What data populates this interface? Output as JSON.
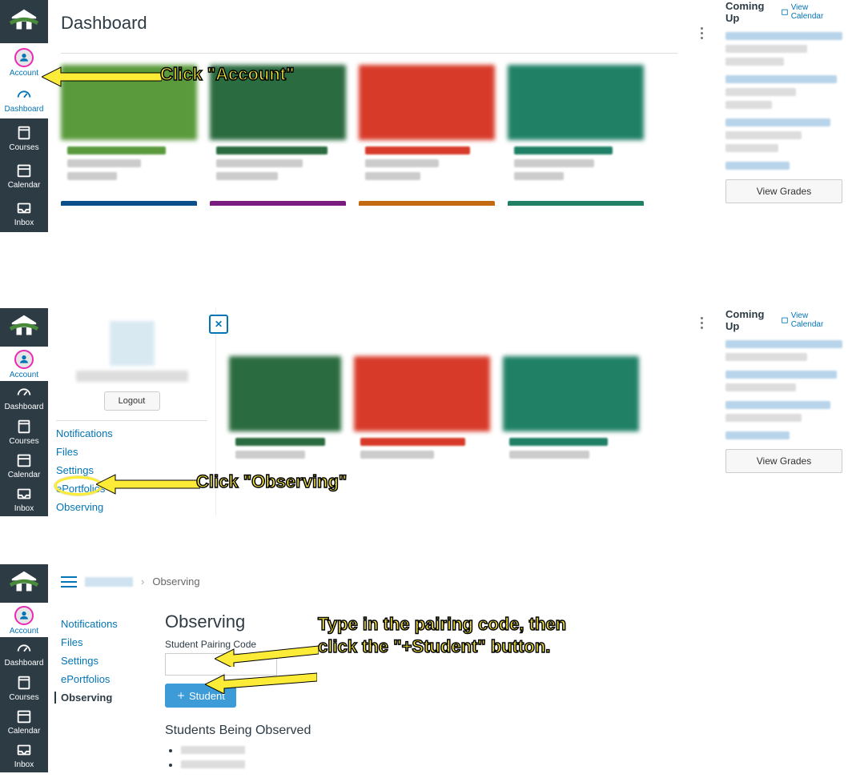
{
  "sidebar": {
    "account": "Account",
    "dashboard": "Dashboard",
    "courses": "Courses",
    "calendar": "Calendar",
    "inbox": "Inbox"
  },
  "dashboard": {
    "title": "Dashboard",
    "coming_up": "Coming Up",
    "view_calendar": "View Calendar",
    "view_grades": "View Grades"
  },
  "tray": {
    "logout": "Logout",
    "links": {
      "notifications": "Notifications",
      "files": "Files",
      "settings": "Settings",
      "eportfolios": "ePortfolios",
      "observing": "Observing"
    }
  },
  "panel3": {
    "breadcrumb_current": "Observing",
    "menu": {
      "notifications": "Notifications",
      "files": "Files",
      "settings": "Settings",
      "eportfolios": "ePortfolios",
      "observing": "Observing"
    },
    "heading": "Observing",
    "label": "Student Pairing Code",
    "add_student": "Student",
    "students_heading": "Students Being Observed"
  },
  "annotations": {
    "a1": "Click \"Account\"",
    "a2": "Click \"Observing\"",
    "a3l1": "Type in the pairing code, then",
    "a3l2": "click the \"+Student\" button."
  },
  "card_colors": {
    "c1": "#5a9a3c",
    "c2": "#2a6b3f",
    "c3": "#d83a2a",
    "c4": "#1f8066",
    "r1": "#0b4f8a",
    "r2": "#7a1c7e",
    "r3": "#c36a10",
    "r4": "#1f8066"
  }
}
